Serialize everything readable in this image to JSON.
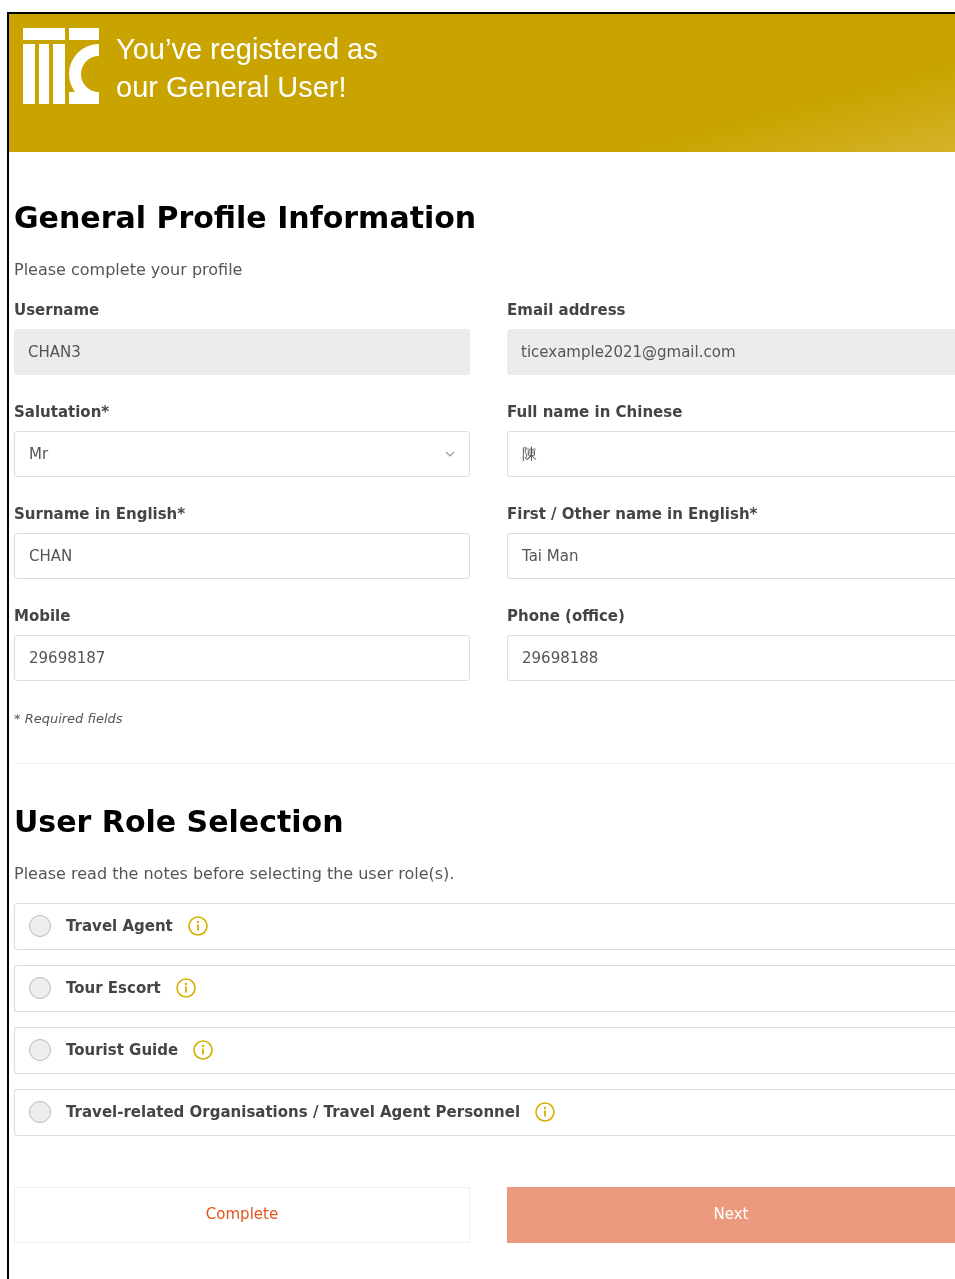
{
  "banner": {
    "title_lines": [
      "You’ve registered as",
      "our General User!"
    ]
  },
  "profile": {
    "heading": "General Profile Information",
    "subtitle": "Please complete your profile",
    "fields": [
      {
        "label": "Username",
        "kind": "readonly",
        "value": "CHAN3"
      },
      {
        "label": "Email address",
        "kind": "readonly",
        "value": "ticexample2021@gmail.com"
      },
      {
        "label": "Salutation*",
        "kind": "select",
        "value": "Mr"
      },
      {
        "label": "Full name in Chinese",
        "kind": "text",
        "value": "陳"
      },
      {
        "label": "Surname in English*",
        "kind": "text",
        "value": "CHAN"
      },
      {
        "label": "First / Other name in English*",
        "kind": "text",
        "value": "Tai Man"
      },
      {
        "label": "Mobile",
        "kind": "text",
        "value": "29698187"
      },
      {
        "label": "Phone (office)",
        "kind": "text",
        "value": "29698188"
      }
    ],
    "required_note": "* Required fields"
  },
  "roles": {
    "heading": "User Role Selection",
    "note": "Please read the notes before selecting the user role(s).",
    "options": [
      {
        "label": "Travel Agent",
        "selected": false
      },
      {
        "label": "Tour Escort",
        "selected": false
      },
      {
        "label": "Tourist Guide",
        "selected": false
      },
      {
        "label": "Travel-related Organisations / Travel Agent Personnel",
        "selected": false
      }
    ]
  },
  "buttons": [
    {
      "label": "Complete",
      "kind": "secondary"
    },
    {
      "label": "Next",
      "kind": "primary"
    }
  ]
}
